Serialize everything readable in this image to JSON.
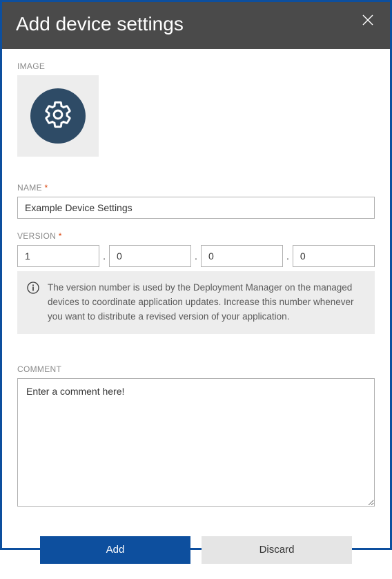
{
  "header": {
    "title": "Add device settings"
  },
  "image": {
    "label": "IMAGE"
  },
  "name": {
    "label": "NAME",
    "value": "Example Device Settings"
  },
  "version": {
    "label": "VERSION",
    "parts": {
      "v0": "1",
      "v1": "0",
      "v2": "0",
      "v3": "0"
    },
    "info": "The version number is used by the Deployment Manager on the managed devices to coordinate application updates. Increase this number whenever you want to distribute a revised version of your application."
  },
  "comment": {
    "label": "COMMENT",
    "value": "Enter a comment here!"
  },
  "footer": {
    "add": "Add",
    "discard": "Discard"
  }
}
